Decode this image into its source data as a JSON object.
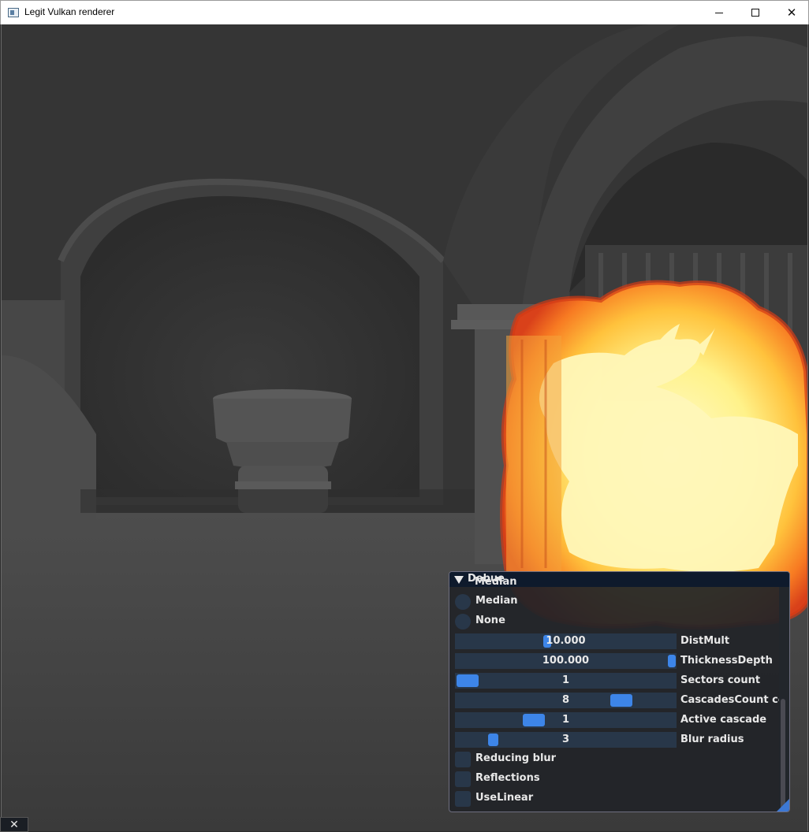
{
  "window": {
    "title": "Legit Vulkan renderer",
    "close_glyph": "✕"
  },
  "debug_panel": {
    "title": "Debue",
    "clipped_item": "Median",
    "options": [
      {
        "type": "radio",
        "label": "Median"
      },
      {
        "type": "radio",
        "label": "None"
      }
    ],
    "sliders": [
      {
        "value": "10.000",
        "label": "DistMult",
        "fraction": 0.42
      },
      {
        "value": "100.000",
        "label": "ThicknessDepth",
        "fraction": 1.0
      },
      {
        "value": "1",
        "label": "Sectors count",
        "fraction": 0.0
      },
      {
        "value": "8",
        "label": "CascadesCount coun",
        "fraction": 0.78
      },
      {
        "value": "1",
        "label": "Active cascade",
        "fraction": 0.34
      },
      {
        "value": "3",
        "label": "Blur radius",
        "fraction": 0.18
      }
    ],
    "checkboxes": [
      {
        "label": "Reducing blur"
      },
      {
        "label": "Reflections"
      },
      {
        "label": "UseLinear"
      }
    ]
  },
  "overlay": {
    "close_glyph": "✕"
  },
  "colors": {
    "accent": "#3d85e8",
    "frame_bg": "#283749",
    "fire_core": "#fff59a",
    "fire_edge": "#e8501c"
  }
}
